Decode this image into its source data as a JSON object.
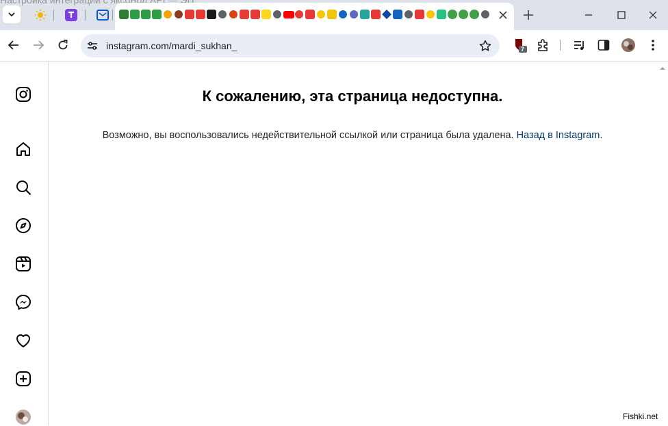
{
  "browser": {
    "url": "instagram.com/mardi_sukhan_",
    "extension_badge": "7",
    "ghost_title": "Настройка интеграции с яксоБод API — ЭЦ"
  },
  "page": {
    "heading": "К сожалению, эта страница недоступна.",
    "message_prefix": "Возможно, вы воспользовались недействительной ссылкой или страница была удалена. ",
    "back_link": "Назад в Instagram",
    "message_suffix": "."
  },
  "sidebar": {
    "items": [
      "instagram-logo",
      "home",
      "search",
      "explore",
      "reels",
      "messages",
      "notifications",
      "create",
      "profile"
    ]
  },
  "watermark": "Fishki.net",
  "colors": {
    "link": "#00376b",
    "tabstrip": "#dee3eb",
    "omnibox": "#e9eef6"
  }
}
